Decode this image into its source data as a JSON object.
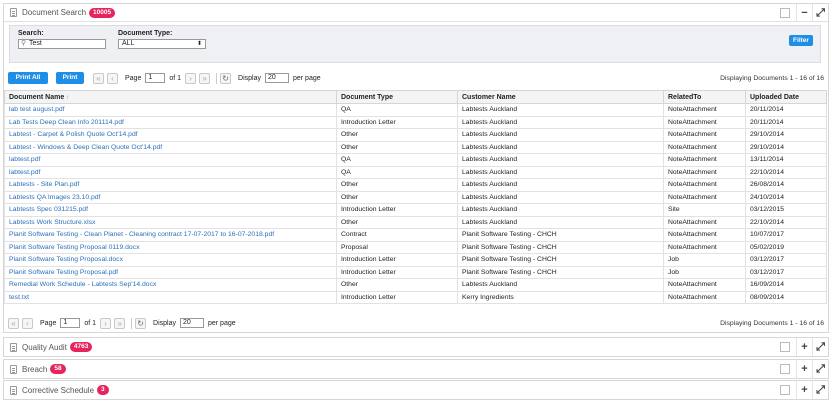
{
  "document_search": {
    "title": "Document Search",
    "badge": "10005",
    "search": {
      "search_label": "Search:",
      "search_value": "Test",
      "doctype_label": "Document Type:",
      "doctype_value": "ALL",
      "filter_label": "Filter"
    },
    "toolbar": {
      "print_all": "Print All",
      "print": "Print",
      "page_label": "Page",
      "page_value": "1",
      "of_label": "of 1",
      "display_label": "Display",
      "display_value": "20",
      "per_page": "per page",
      "displaying": "Displaying Documents 1 - 16 of 16"
    },
    "columns": [
      "Document Name",
      "Document Type",
      "Customer Name",
      "RelatedTo",
      "Uploaded Date"
    ],
    "sort_arrow": "↑",
    "rows": [
      [
        "lab test august.pdf",
        "QA",
        "Labtests Auckland",
        "NoteAttachment",
        "20/11/2014"
      ],
      [
        "Lab Tests Deep Clean Info 201114.pdf",
        "Introduction Letter",
        "Labtests Auckland",
        "NoteAttachment",
        "20/11/2014"
      ],
      [
        "Labtest - Carpet & Polish Quote Oct'14.pdf",
        "Other",
        "Labtests Auckland",
        "NoteAttachment",
        "29/10/2014"
      ],
      [
        "Labtest - Windows & Deep Clean Quote Oct'14.pdf",
        "Other",
        "Labtests Auckland",
        "NoteAttachment",
        "29/10/2014"
      ],
      [
        "labtest.pdf",
        "QA",
        "Labtests Auckland",
        "NoteAttachment",
        "13/11/2014"
      ],
      [
        "labtest.pdf",
        "QA",
        "Labtests Auckland",
        "NoteAttachment",
        "22/10/2014"
      ],
      [
        "Labtests - Site Plan.pdf",
        "Other",
        "Labtests Auckland",
        "NoteAttachment",
        "26/08/2014"
      ],
      [
        "Labtests QA Images 23.10.pdf",
        "Other",
        "Labtests Auckland",
        "NoteAttachment",
        "24/10/2014"
      ],
      [
        "Labtests Spec 031215.pdf",
        "Introduction Letter",
        "Labtests Auckland",
        "Site",
        "03/12/2015"
      ],
      [
        "Labtests Work Structure.xlsx",
        "Other",
        "Labtests Auckland",
        "NoteAttachment",
        "22/10/2014"
      ],
      [
        "Planit Software Testing - Clean Planet - Cleaning contract 17-07-2017 to 16-07-2018.pdf",
        "Contract",
        "Planit Software Testing - CHCH",
        "NoteAttachment",
        "10/07/2017"
      ],
      [
        "Planit Software Testing Proposal 0119.docx",
        "Proposal",
        "Planit Software Testing - CHCH",
        "NoteAttachment",
        "05/02/2019"
      ],
      [
        "Planit Software Testing Proposal.docx",
        "Introduction Letter",
        "Planit Software Testing - CHCH",
        "Job",
        "03/12/2017"
      ],
      [
        "Planit Software Testing Proposal.pdf",
        "Introduction Letter",
        "Planit Software Testing - CHCH",
        "Job",
        "03/12/2017"
      ],
      [
        "Remedial Work Schedule - Labtests Sep'14.docx",
        "Other",
        "Labtests Auckland",
        "NoteAttachment",
        "16/09/2014"
      ],
      [
        "test.txt",
        "Introduction Letter",
        "Kerry Ingredients",
        "NoteAttachment",
        "08/09/2014"
      ]
    ]
  },
  "panels": [
    {
      "title": "Quality Audit",
      "badge": "4763"
    },
    {
      "title": "Breach",
      "badge": "58"
    },
    {
      "title": "Corrective Schedule",
      "badge": "3"
    }
  ],
  "icons": {
    "minimize": "−",
    "expand": "⤢",
    "add": "+",
    "first": "«",
    "prev": "‹",
    "next": "›",
    "last": "»",
    "refresh": "↻"
  }
}
